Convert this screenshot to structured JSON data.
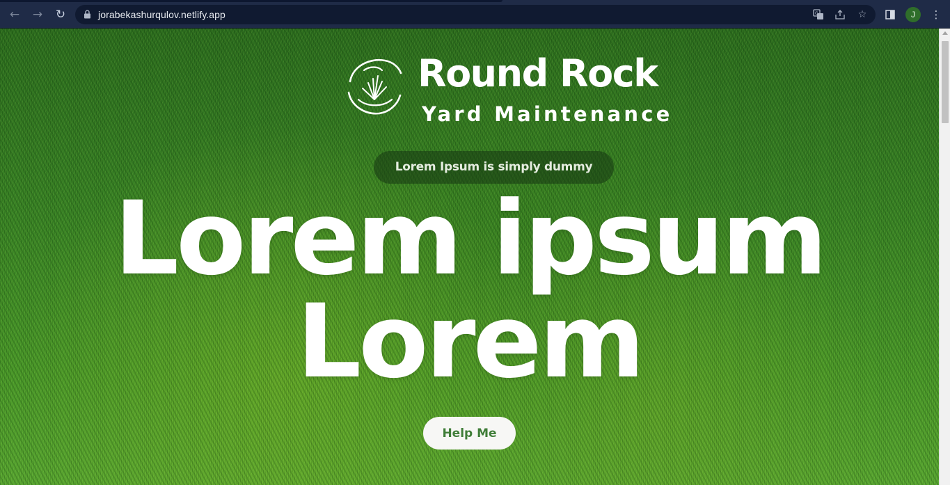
{
  "browser": {
    "url": "jorabekashurqulov.netlify.app",
    "profile_initial": "J",
    "icons": {
      "back": "arrow-left-icon",
      "forward": "arrow-right-icon",
      "reload": "reload-icon",
      "lock": "lock-icon",
      "translate": "translate-icon",
      "share": "share-icon",
      "bookmark": "star-icon",
      "side_panel": "side-panel-icon",
      "menu": "kebab-menu-icon"
    }
  },
  "hero": {
    "brand_name": "Round Rock",
    "brand_subtitle": "Yard Maintenance",
    "badge_text": "Lorem Ipsum is simply dummy",
    "headline_line1": "Lorem ipsum",
    "headline_line2": "Lorem",
    "cta_label": "Help Me"
  },
  "colors": {
    "chrome_bg": "#1f2b47",
    "omnibox_bg": "#101a31",
    "grass_green": "#3a8426",
    "cta_text": "#3f7d38",
    "avatar_bg": "#2f6e2a"
  }
}
